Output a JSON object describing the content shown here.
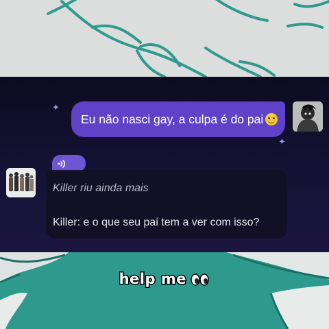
{
  "chat": {
    "user_message": "Eu não nasci gay, a culpa é do pai",
    "user_message_emoji": "slightly-smiling-face-icon",
    "bot_action": "Killer riu ainda mais",
    "bot_speech": "Killer: e o que seu pai tem a ver com isso?",
    "voice_icon": "sound-wave-icon"
  },
  "caption": {
    "text": "help me",
    "emoji": "eyes-icon"
  },
  "colors": {
    "user_bubble": "#5f42c8",
    "chat_background": "#151235",
    "voice_button": "#6e55d4",
    "teal_background": "#2e9a8e"
  }
}
